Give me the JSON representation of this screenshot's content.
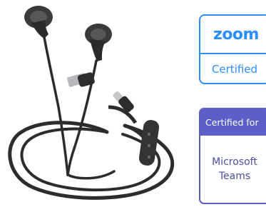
{
  "badges": {
    "zoom": {
      "logo": "zoom",
      "label": "Certified",
      "color": "#2d8cff"
    },
    "teams": {
      "header": "Certified for",
      "line1": "Microsoft",
      "line2": "Teams",
      "color": "#5b5fc7"
    }
  },
  "product": {
    "image": "wired-earbuds-usb-c-with-usb-a-adapter-and-inline-remote",
    "color": "#2b2b2b"
  }
}
